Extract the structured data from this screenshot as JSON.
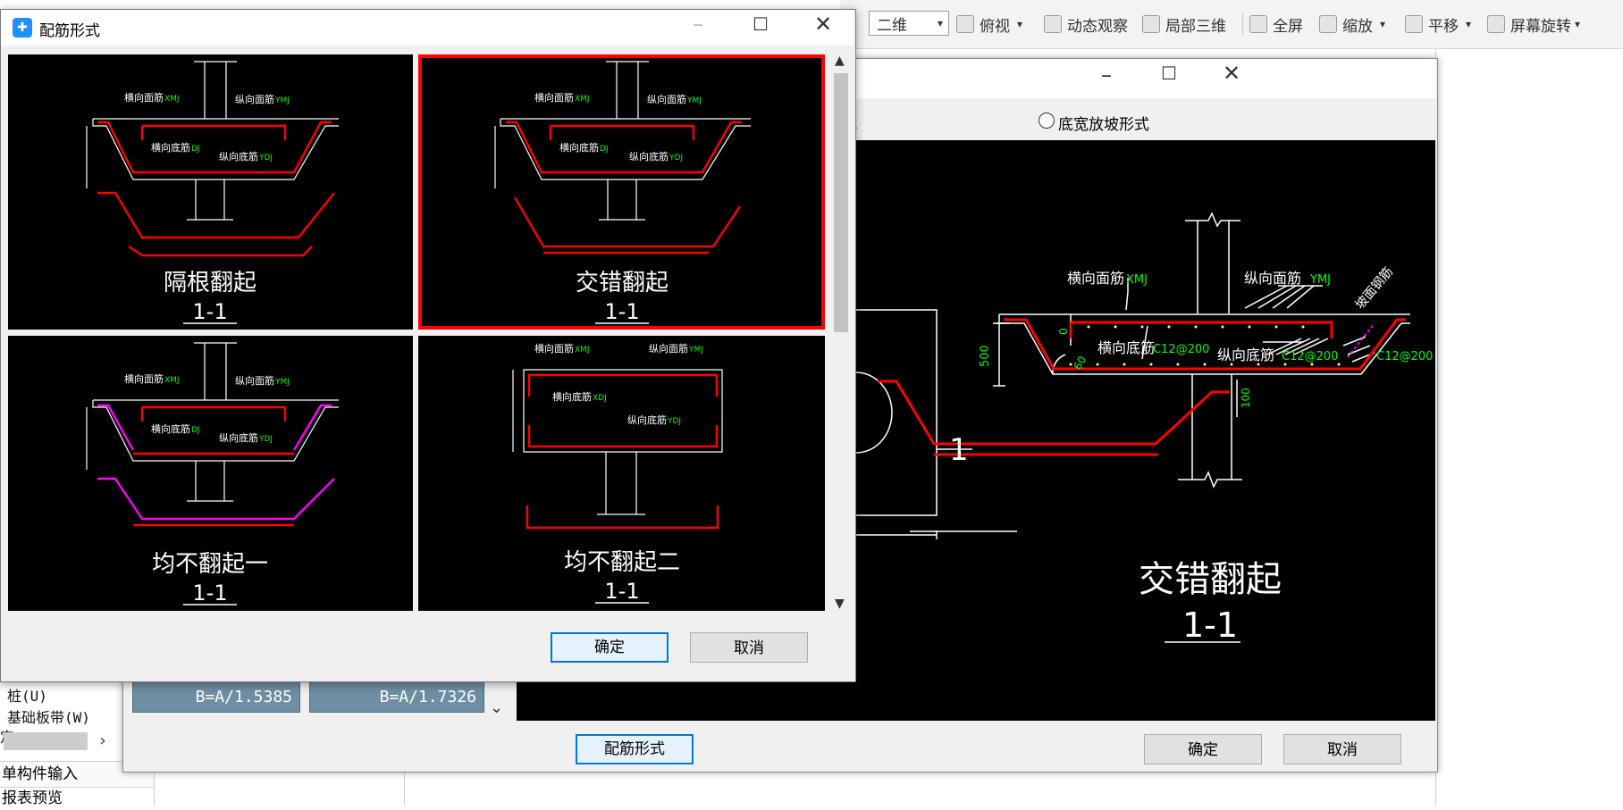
{
  "toolbar": {
    "view_select": "二维",
    "items": [
      "俯视",
      "动态观察",
      "局部三维",
      "全屏",
      "缩放",
      "平移",
      "屏幕旋转"
    ]
  },
  "left_panel": {
    "tree_items": [
      "桩(U)",
      "基础板带(W)",
      "定"
    ],
    "tabs": [
      "单构件输入",
      "报表预览"
    ]
  },
  "back_dialog": {
    "radio_partial": "式",
    "radio_option": "底宽放坡形式",
    "cell_values": [
      "B=A/1.5385",
      "B=A/1.7326"
    ],
    "preview": {
      "labels": {
        "hxmj": "横向面筋",
        "hxmj_code": "XMJ",
        "zxmj": "纵向面筋",
        "zxmj_code": "YMJ",
        "hxdj": "横向底筋",
        "hxdj_code": "C12@200",
        "zxdj": "纵向底筋",
        "zxdj_code": "C12@200",
        "slope": "C12@200",
        "pomian": "坡面钢筋",
        "dim_500": "500",
        "dim_0": "0",
        "dim_100": "100",
        "angle": "60"
      },
      "title": "交错翻起",
      "subtitle": "1-1",
      "section_mark": "1"
    },
    "buttons": {
      "rebar_form": "配筋形式",
      "ok": "确定",
      "cancel": "取消"
    }
  },
  "front_dialog": {
    "title": "配筋形式",
    "options": [
      {
        "name": "隔根翻起",
        "sub": "1-1",
        "selected": false
      },
      {
        "name": "交错翻起",
        "sub": "1-1",
        "selected": true
      },
      {
        "name": "均不翻起一",
        "sub": "1-1",
        "selected": false
      },
      {
        "name": "均不翻起二",
        "sub": "1-1",
        "selected": false
      }
    ],
    "buttons": {
      "ok": "确定",
      "cancel": "取消"
    }
  },
  "colors": {
    "rebar": "#ff0000",
    "label": "#00ff00",
    "line": "#ffffff",
    "magenta": "#ff00ff",
    "selection": "#ff0000"
  }
}
